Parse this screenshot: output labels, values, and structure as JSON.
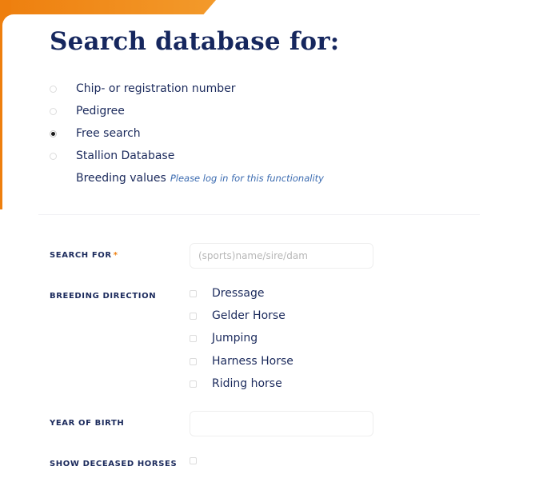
{
  "heading": "Search database for:",
  "search_type": {
    "options": [
      {
        "label": "Chip- or registration number",
        "checked": false
      },
      {
        "label": "Pedigree",
        "checked": false
      },
      {
        "label": "Free search",
        "checked": true
      },
      {
        "label": "Stallion Database",
        "checked": false
      }
    ],
    "breeding_values": {
      "label": "Breeding values",
      "hint": "Please log in for this functionality"
    }
  },
  "form": {
    "search_for": {
      "label": "SEARCH FOR",
      "required_mark": "*",
      "placeholder": "(sports)name/sire/dam",
      "value": ""
    },
    "breeding_direction": {
      "label": "BREEDING DIRECTION",
      "options": [
        "Dressage",
        "Gelder Horse",
        "Jumping",
        "Harness Horse",
        "Riding horse"
      ]
    },
    "year_of_birth": {
      "label": "YEAR OF BIRTH",
      "value": ""
    },
    "show_deceased": {
      "label": "SHOW DECEASED HORSES",
      "checked": false
    }
  },
  "colors": {
    "accent": "#ee7f0e",
    "navy": "#16275e",
    "hint": "#3b6bb0"
  }
}
